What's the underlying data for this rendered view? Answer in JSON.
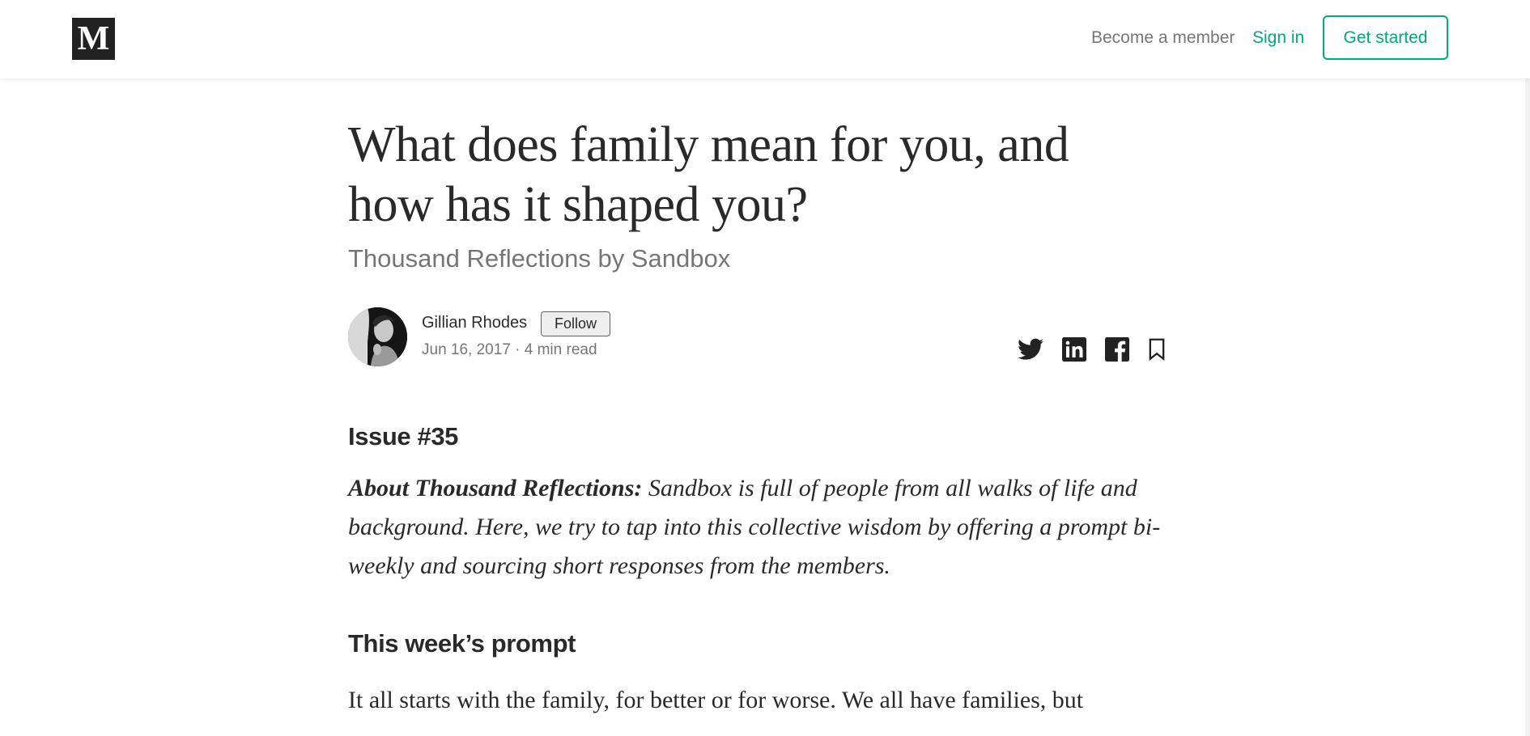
{
  "header": {
    "logo_letter": "M",
    "become_member": "Become a member",
    "sign_in": "Sign in",
    "get_started": "Get started"
  },
  "colors": {
    "accent": "#03a87c",
    "text_primary": "#292929",
    "text_secondary": "#757575"
  },
  "article": {
    "title": "What does family mean for you, and how has it shaped you?",
    "subtitle": "Thousand Reflections by Sandbox",
    "author": {
      "name": "Gillian Rhodes",
      "follow_label": "Follow",
      "meta": "Jun 16, 2017 · 4 min read"
    },
    "share_icons": [
      "twitter-icon",
      "linkedin-icon",
      "facebook-icon",
      "bookmark-icon"
    ],
    "issue_heading": "Issue #35",
    "about_label": "About Thousand Reflections:",
    "about_text": " Sandbox is full of people from all walks of life and background. Here, we try to tap into this collective wisdom by offering a prompt bi-weekly and sourcing short responses from the members.",
    "prompt_heading": "This week’s prompt",
    "prompt_text": "It all starts with the family, for better or for worse. We all have families, but"
  }
}
